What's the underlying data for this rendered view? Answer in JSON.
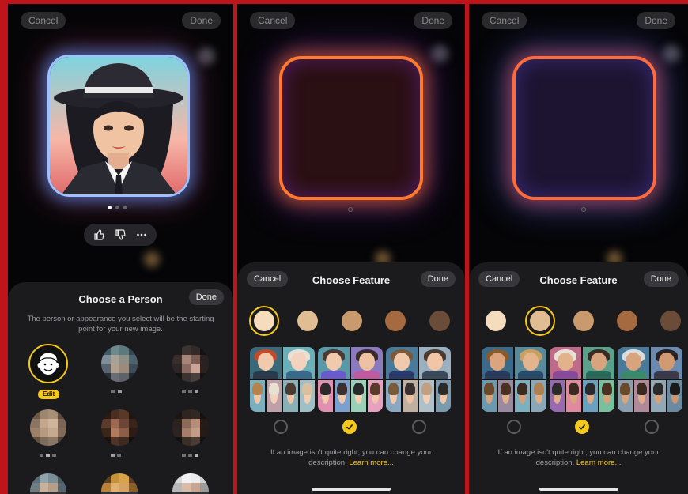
{
  "colors": {
    "accent": "#f5c91c",
    "background": "#050507",
    "sheet": "#1b1b1e",
    "divider": "#c0141b"
  },
  "screen1": {
    "top_cancel": "Cancel",
    "top_done": "Done",
    "feedback_icons": [
      "thumbs-up-icon",
      "thumbs-down-icon",
      "more-icon"
    ],
    "sheet": {
      "title": "Choose a Person",
      "done": "Done",
      "description": "The person or appearance you select will be the starting point for your new image.",
      "edit_label": "Edit"
    }
  },
  "screen2": {
    "top_cancel": "Cancel",
    "top_done": "Done",
    "sheet": {
      "cancel": "Cancel",
      "title": "Choose Feature",
      "done": "Done",
      "selected_tone": 1,
      "selected_option": 2
    },
    "footnote": "If an image isn't quite right, you can change your description.",
    "footnote_link": "Learn more..."
  },
  "screen3": {
    "top_cancel": "Cancel",
    "top_done": "Done",
    "sheet": {
      "cancel": "Cancel",
      "title": "Choose Feature",
      "done": "Done",
      "selected_tone": 2,
      "selected_option": 2
    },
    "footnote": "If an image isn't quite right, you can change your description.",
    "footnote_link": "Learn more..."
  },
  "skin_tones": [
    "#f4dcbc",
    "#e0bd93",
    "#c99a6d",
    "#a66a40",
    "#6a4c38"
  ]
}
